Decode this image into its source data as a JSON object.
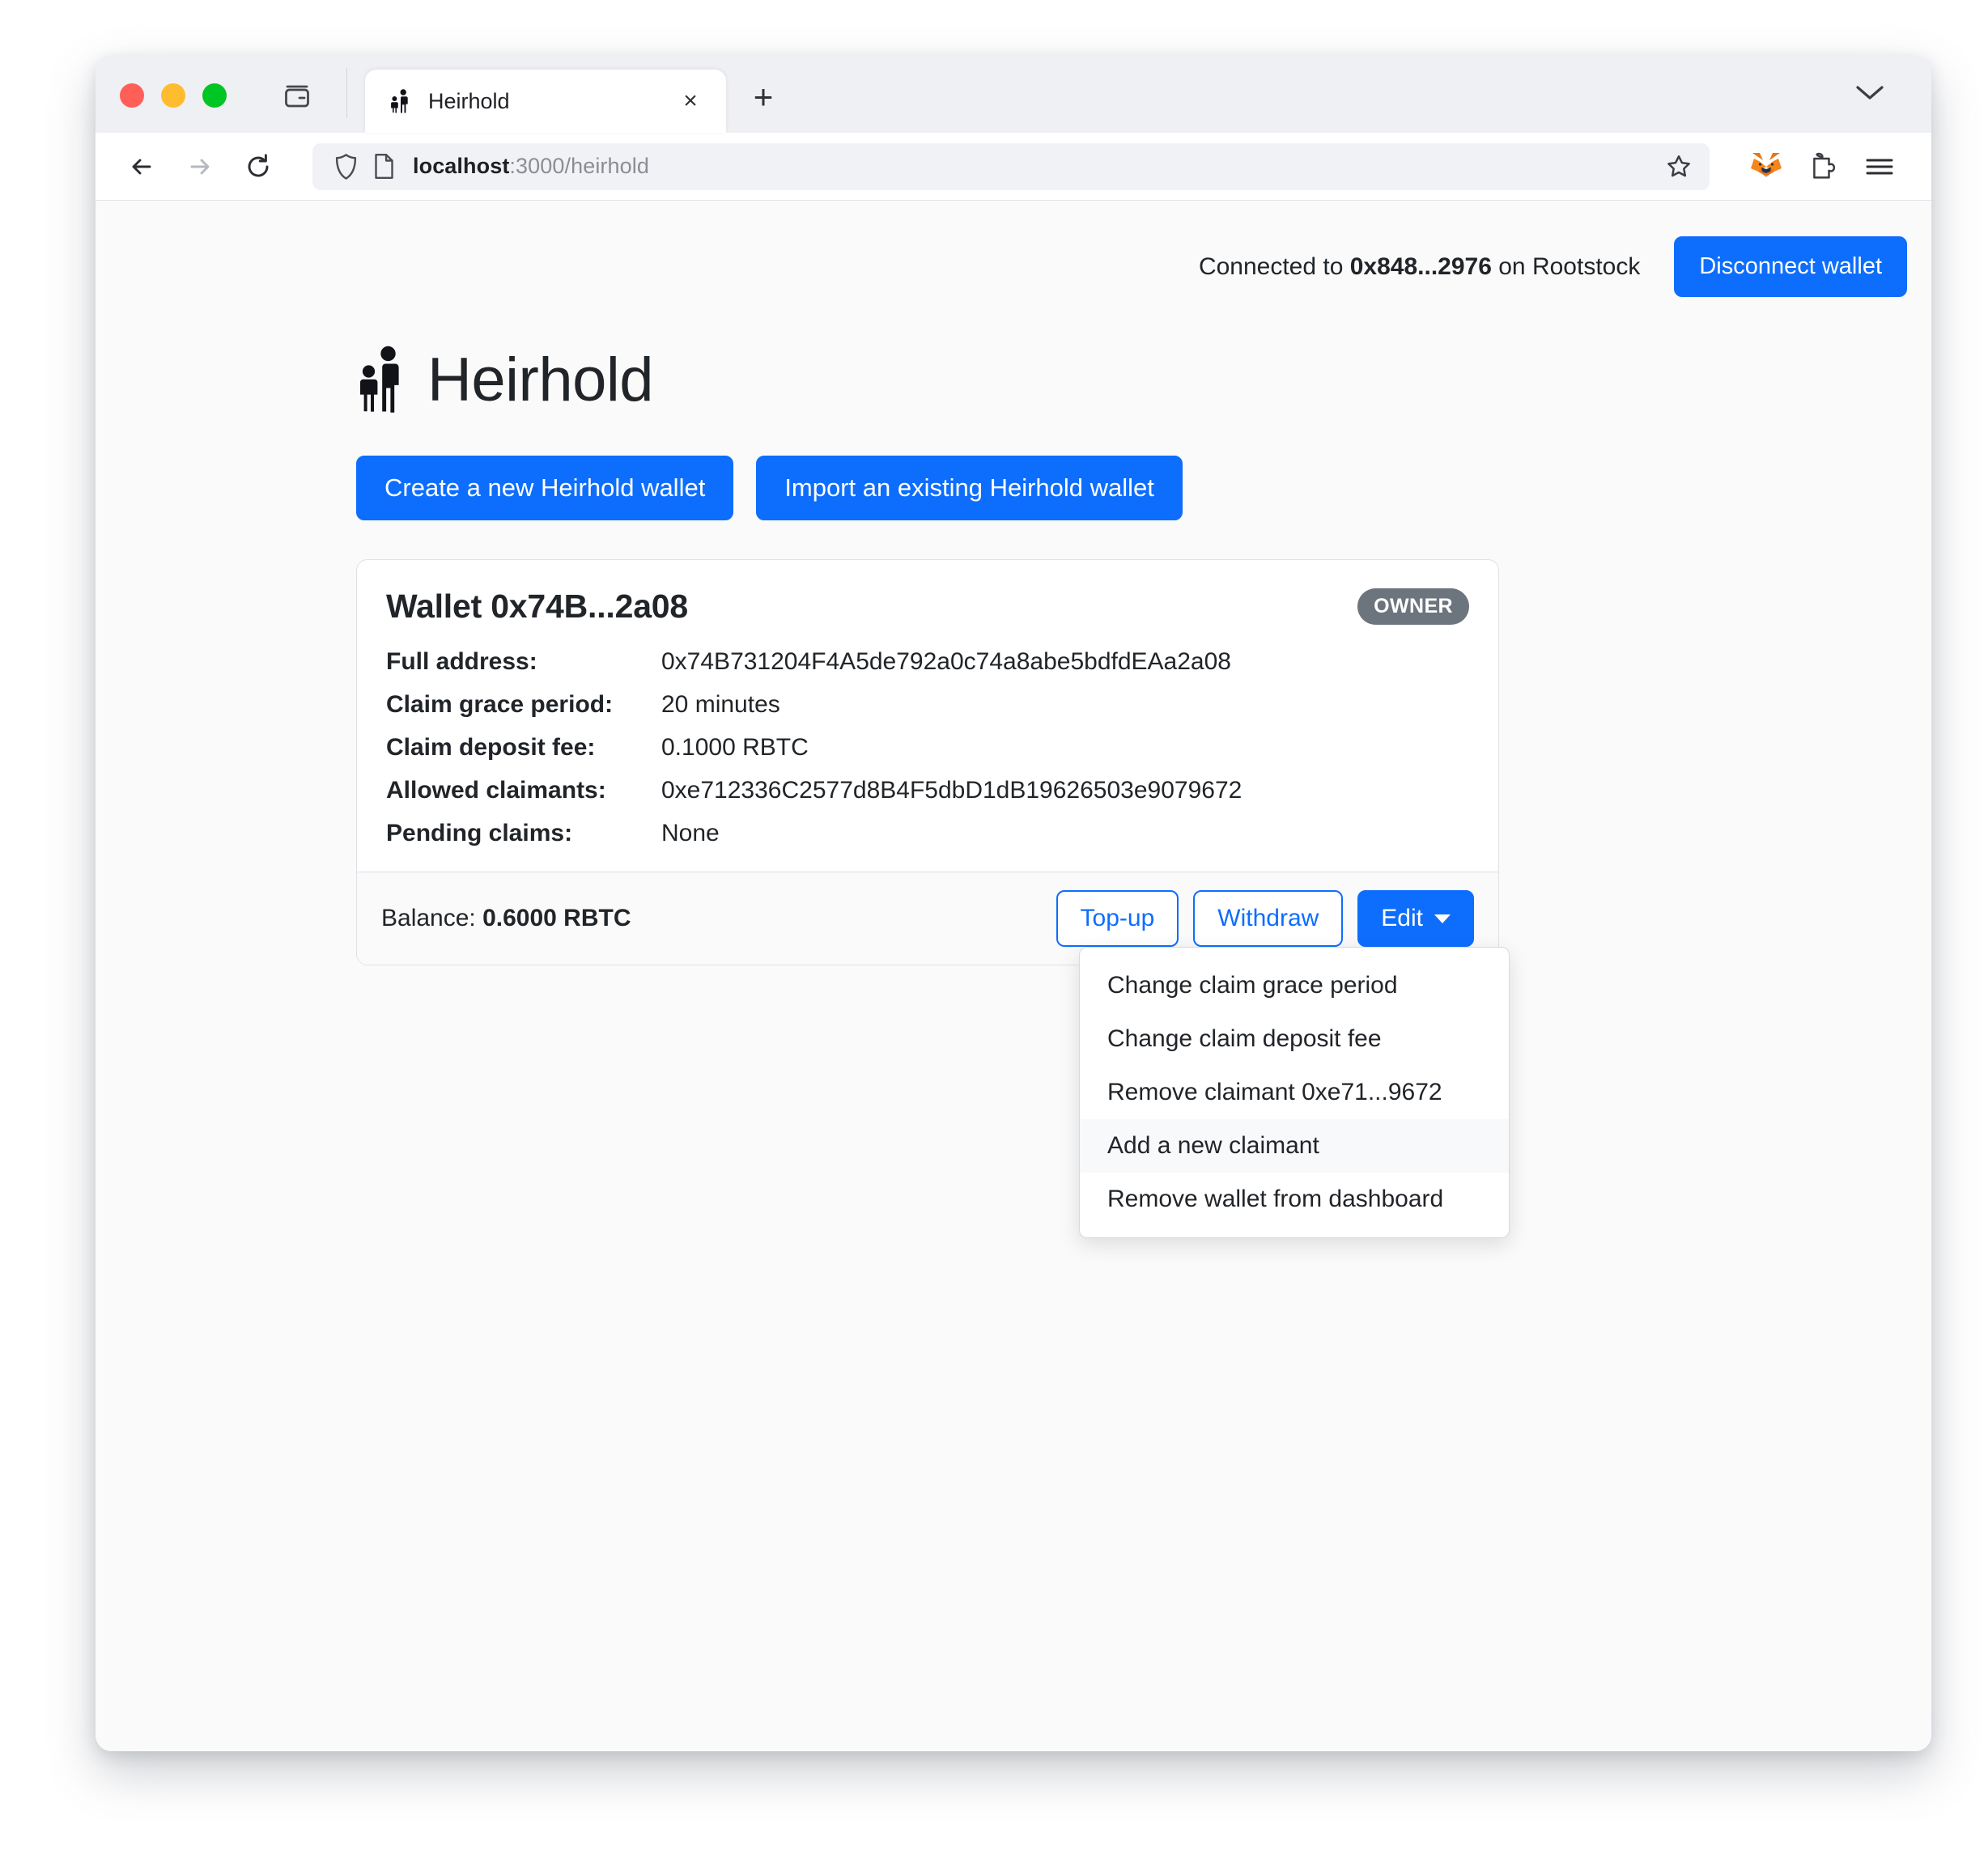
{
  "browser": {
    "traffic_lights": [
      "close",
      "minimize",
      "zoom"
    ],
    "tab": {
      "title": "Heirhold",
      "favicon": "heirhold-logo-icon",
      "close_label": "×"
    },
    "new_tab_label": "+",
    "toolbar": {
      "back_icon": "back-arrow-icon",
      "forward_icon": "forward-arrow-icon",
      "reload_icon": "reload-icon",
      "shield_icon": "shield-icon",
      "page_icon": "page-document-icon",
      "url_host": "localhost",
      "url_path": ":3000/heirhold",
      "star_icon": "bookmark-star-icon",
      "metamask_icon": "metamask-fox-icon",
      "extensions_icon": "puzzle-piece-icon",
      "menu_icon": "hamburger-menu-icon"
    }
  },
  "page": {
    "wallet_bar": {
      "status_prefix": "Connected to ",
      "status_address": "0x848...2976",
      "status_suffix": " on Rootstock",
      "disconnect_label": "Disconnect wallet"
    },
    "brand": {
      "name": "Heirhold",
      "logo": "heirhold-family-logo-icon"
    },
    "cta": {
      "create_label": "Create a new Heirhold wallet",
      "import_label": "Import an existing Heirhold wallet"
    },
    "wallet_card": {
      "title": "Wallet 0x74B...2a08",
      "badge": "OWNER",
      "details": [
        {
          "label": "Full address:",
          "value": "0x74B731204F4A5de792a0c74a8abe5bdfdEAa2a08"
        },
        {
          "label": "Claim grace period:",
          "value": "20 minutes"
        },
        {
          "label": "Claim deposit fee:",
          "value": "0.1000 RBTC"
        },
        {
          "label": "Allowed claimants:",
          "value": "0xe712336C2577d8B4F5dbD1dB19626503e9079672"
        },
        {
          "label": "Pending claims:",
          "value": "None"
        }
      ],
      "footer": {
        "balance_label": "Balance: ",
        "balance_value": "0.6000 RBTC",
        "topup_label": "Top-up",
        "withdraw_label": "Withdraw",
        "edit_label": "Edit"
      },
      "edit_menu": [
        {
          "label": "Change claim grace period",
          "active": false
        },
        {
          "label": "Change claim deposit fee",
          "active": false
        },
        {
          "label": "Remove claimant 0xe71...9672",
          "active": false
        },
        {
          "label": "Add a new claimant",
          "active": true
        },
        {
          "label": "Remove wallet from dashboard",
          "active": false
        }
      ]
    }
  },
  "colors": {
    "primary": "#0d6efd",
    "badge_gray": "#6c757d",
    "text": "#212529",
    "card_border": "#dee2e6",
    "hover": "#f8f9fa"
  }
}
